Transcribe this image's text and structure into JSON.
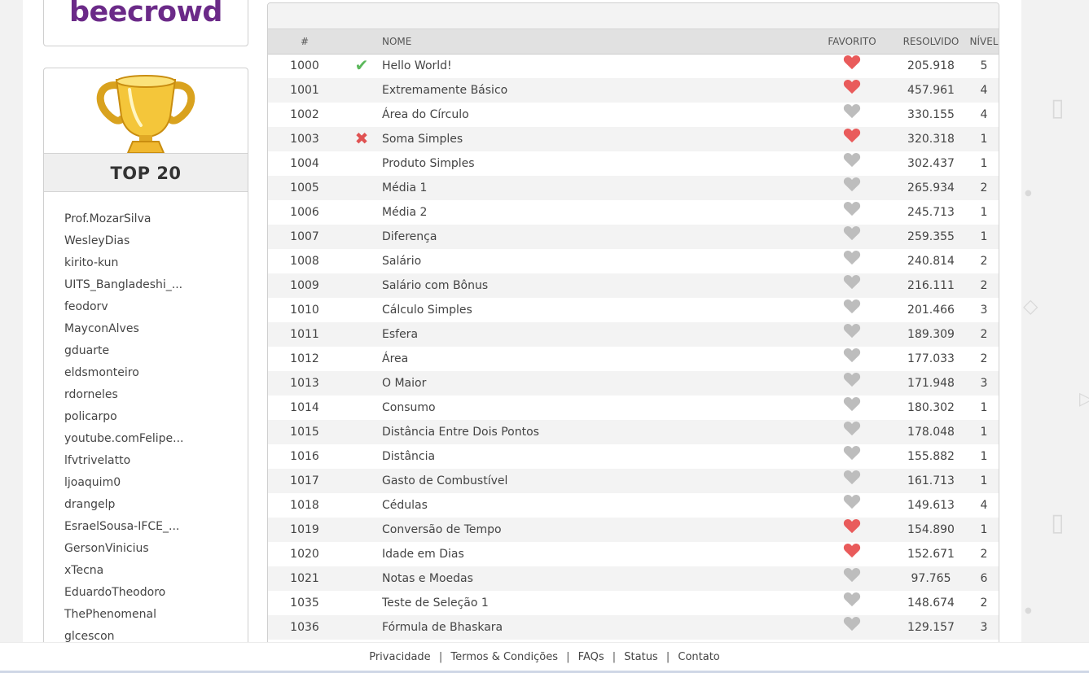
{
  "logo": {
    "text": "beecrowd"
  },
  "top20": {
    "title": "TOP 20",
    "users": [
      "Prof.MozarSilva",
      "WesleyDias",
      "kirito-kun",
      "UITS_Bangladeshi_...",
      "feodorv",
      "MayconAlves",
      "gduarte",
      "eldsmonteiro",
      "rdorneles",
      "policarpo",
      "youtube.comFelipe...",
      "lfvtrivelatto",
      "ljoaquim0",
      "drangelp",
      "EsraelSousa-IFCE_...",
      "GersonVinicius",
      "xTecna",
      "EduardoTheodoro",
      "ThePhenomenal",
      "glcescon"
    ]
  },
  "table": {
    "headers": {
      "id": "#",
      "name": "NOME",
      "favorite": "FAVORITO",
      "solved": "RESOLVIDO",
      "level": "NÍVEL"
    },
    "rows": [
      {
        "id": "1000",
        "status": "ok",
        "name": "Hello World!",
        "fav": true,
        "solved": "205.918",
        "level": "5"
      },
      {
        "id": "1001",
        "status": "",
        "name": "Extremamente Básico",
        "fav": true,
        "solved": "457.961",
        "level": "4"
      },
      {
        "id": "1002",
        "status": "",
        "name": "Área do Círculo",
        "fav": false,
        "solved": "330.155",
        "level": "4"
      },
      {
        "id": "1003",
        "status": "wrong",
        "name": "Soma Simples",
        "fav": true,
        "solved": "320.318",
        "level": "1"
      },
      {
        "id": "1004",
        "status": "",
        "name": "Produto Simples",
        "fav": false,
        "solved": "302.437",
        "level": "1"
      },
      {
        "id": "1005",
        "status": "",
        "name": "Média 1",
        "fav": false,
        "solved": "265.934",
        "level": "2"
      },
      {
        "id": "1006",
        "status": "",
        "name": "Média 2",
        "fav": false,
        "solved": "245.713",
        "level": "1"
      },
      {
        "id": "1007",
        "status": "",
        "name": "Diferença",
        "fav": false,
        "solved": "259.355",
        "level": "1"
      },
      {
        "id": "1008",
        "status": "",
        "name": "Salário",
        "fav": false,
        "solved": "240.814",
        "level": "2"
      },
      {
        "id": "1009",
        "status": "",
        "name": "Salário com Bônus",
        "fav": false,
        "solved": "216.111",
        "level": "2"
      },
      {
        "id": "1010",
        "status": "",
        "name": "Cálculo Simples",
        "fav": false,
        "solved": "201.466",
        "level": "3"
      },
      {
        "id": "1011",
        "status": "",
        "name": "Esfera",
        "fav": false,
        "solved": "189.309",
        "level": "2"
      },
      {
        "id": "1012",
        "status": "",
        "name": "Área",
        "fav": false,
        "solved": "177.033",
        "level": "2"
      },
      {
        "id": "1013",
        "status": "",
        "name": "O Maior",
        "fav": false,
        "solved": "171.948",
        "level": "3"
      },
      {
        "id": "1014",
        "status": "",
        "name": "Consumo",
        "fav": false,
        "solved": "180.302",
        "level": "1"
      },
      {
        "id": "1015",
        "status": "",
        "name": "Distância Entre Dois Pontos",
        "fav": false,
        "solved": "178.048",
        "level": "1"
      },
      {
        "id": "1016",
        "status": "",
        "name": "Distância",
        "fav": false,
        "solved": "155.882",
        "level": "1"
      },
      {
        "id": "1017",
        "status": "",
        "name": "Gasto de Combustível",
        "fav": false,
        "solved": "161.713",
        "level": "1"
      },
      {
        "id": "1018",
        "status": "",
        "name": "Cédulas",
        "fav": false,
        "solved": "149.613",
        "level": "4"
      },
      {
        "id": "1019",
        "status": "",
        "name": "Conversão de Tempo",
        "fav": true,
        "solved": "154.890",
        "level": "1"
      },
      {
        "id": "1020",
        "status": "",
        "name": "Idade em Dias",
        "fav": true,
        "solved": "152.671",
        "level": "2"
      },
      {
        "id": "1021",
        "status": "",
        "name": "Notas e Moedas",
        "fav": false,
        "solved": "97.765",
        "level": "6"
      },
      {
        "id": "1035",
        "status": "",
        "name": "Teste de Seleção 1",
        "fav": false,
        "solved": "148.674",
        "level": "2"
      },
      {
        "id": "1036",
        "status": "",
        "name": "Fórmula de Bhaskara",
        "fav": false,
        "solved": "129.157",
        "level": "3"
      }
    ]
  },
  "footer": {
    "links": [
      "Privacidade",
      "Termos & Condições",
      "FAQs",
      "Status",
      "Contato"
    ]
  },
  "colors": {
    "brand": "#6b2a88",
    "heart_on": "#e95b5b",
    "heart_off": "#bdbdbd",
    "ok": "#5cb85c",
    "wrong": "#e05252"
  }
}
